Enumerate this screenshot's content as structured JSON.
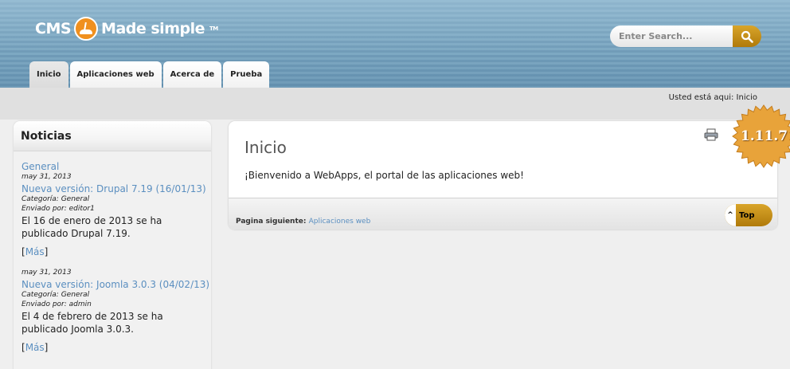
{
  "header": {
    "logo_text": "CMS Made Simple",
    "logo_tm": "TM",
    "search_placeholder": "Enter Search...",
    "search_icon": "magnifier-icon"
  },
  "tabs": [
    {
      "label": "Inicio",
      "active": true
    },
    {
      "label": "Aplicaciones web",
      "active": false
    },
    {
      "label": "Acerca de",
      "active": false
    },
    {
      "label": "Prueba",
      "active": false
    }
  ],
  "breadcrumb": "Usted está aqui: Inicio",
  "sidebar": {
    "title": "Noticias",
    "items": [
      {
        "category_link": "General",
        "date": "may 31, 2013",
        "title": "Nueva versión: Drupal 7.19 (16/01/13)",
        "category": "Categoría: General",
        "author": "Enviado por: editor1",
        "body": "El 16 de enero de 2013 se ha publicado Drupal 7.19.",
        "more_open": "[",
        "more_label": "Más",
        "more_close": "]"
      },
      {
        "date": "may 31, 2013",
        "title": "Nueva versión: Joomla 3.0.3 (04/02/13)",
        "category": "Categoría: General",
        "author": "Enviado por: admin",
        "body": "El 4 de febrero de 2013 se ha publicado Joomla 3.0.3.",
        "more_open": "[",
        "more_label": "Más",
        "more_close": "]"
      }
    ]
  },
  "main": {
    "title": "Inicio",
    "body": "¡Bienvenido a WebApps, el portal de las aplicaciones web!",
    "next_label": "Pagina siguiente:",
    "next_link": "Aplicaciones web",
    "top_button": "Top",
    "top_arrow": "^",
    "print_icon": "printer-icon"
  },
  "version_badge": "1.11.7",
  "colors": {
    "link": "#5b8fc0",
    "accent": "#c48a14",
    "badge": "#e8a33a"
  }
}
